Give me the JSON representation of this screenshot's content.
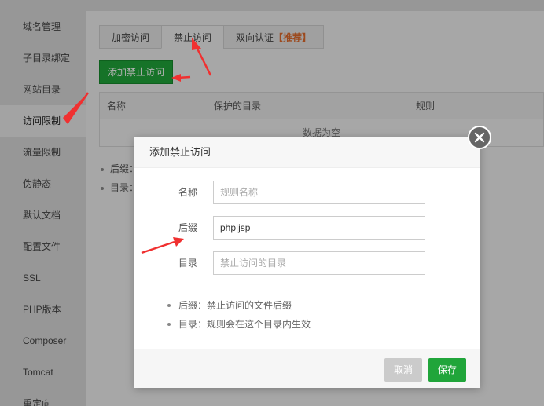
{
  "sidebar": {
    "items": [
      {
        "label": "域名管理"
      },
      {
        "label": "子目录绑定"
      },
      {
        "label": "网站目录"
      },
      {
        "label": "访问限制"
      },
      {
        "label": "流量限制"
      },
      {
        "label": "伪静态"
      },
      {
        "label": "默认文档"
      },
      {
        "label": "配置文件"
      },
      {
        "label": "SSL"
      },
      {
        "label": "PHP版本"
      },
      {
        "label": "Composer"
      },
      {
        "label": "Tomcat"
      },
      {
        "label": "重定向"
      }
    ],
    "active_index": 3
  },
  "tabs": [
    {
      "label": "加密访问"
    },
    {
      "label": "禁止访问"
    },
    {
      "label": "双向认证",
      "tag": "【推荐】"
    }
  ],
  "add_button": "添加禁止访问",
  "table": {
    "headers": [
      "名称",
      "保护的目录",
      "规则"
    ],
    "empty_text": "数据为空"
  },
  "bg_tips": [
    "后缀：",
    "目录："
  ],
  "dialog": {
    "title": "添加禁止访问",
    "name_label": "名称",
    "name_placeholder": "规则名称",
    "suffix_label": "后缀",
    "suffix_value": "php|jsp",
    "dir_label": "目录",
    "dir_placeholder": "禁止访问的目录",
    "tips": [
      "后缀：禁止访问的文件后缀",
      "目录：规则会在这个目录内生效"
    ],
    "cancel_label": "取消",
    "save_label": "保存"
  },
  "colors": {
    "accent_green": "#20a53a",
    "annotation_red": "#f03030",
    "tag_orange": "#e06a2c"
  }
}
